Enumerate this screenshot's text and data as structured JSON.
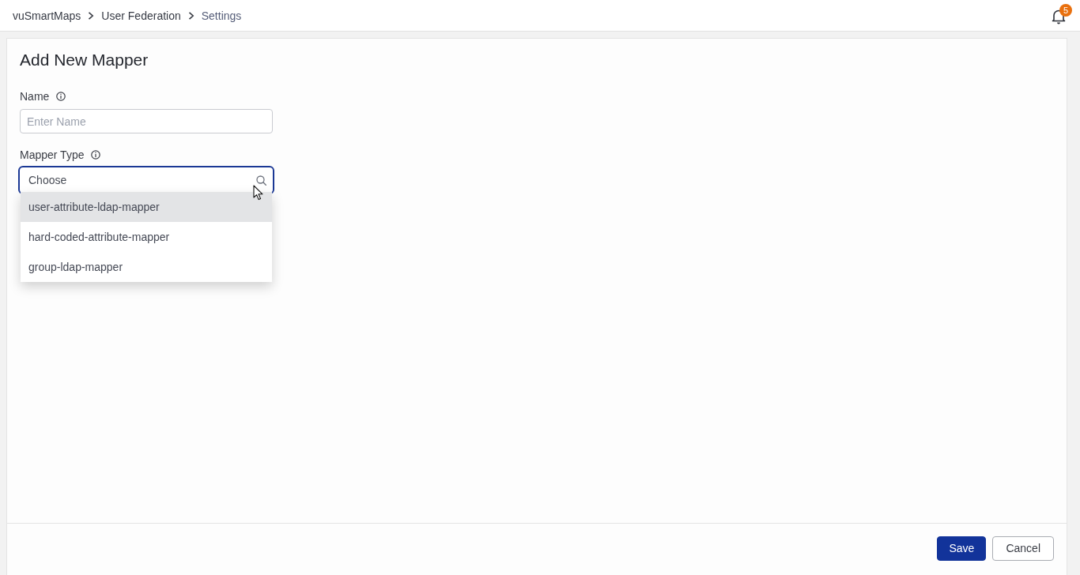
{
  "breadcrumb": [
    {
      "label": "vuSmartMaps",
      "current": false
    },
    {
      "label": "User Federation",
      "current": false
    },
    {
      "label": "Settings",
      "current": true
    }
  ],
  "notifications": {
    "count": "5"
  },
  "form": {
    "title": "Add New Mapper",
    "fields": [
      {
        "kind": "text",
        "label": "Name",
        "placeholder": "Enter Name"
      },
      {
        "kind": "select",
        "label": "Mapper Type",
        "placeholder": "Choose",
        "focused": true,
        "expanded": true,
        "options": [
          {
            "label": "user-attribute-ldap-mapper",
            "selected": true
          },
          {
            "label": "hard-coded-attribute-mapper",
            "selected": false
          },
          {
            "label": "group-ldap-mapper",
            "selected": false
          }
        ]
      }
    ]
  },
  "buttons": [
    {
      "label": "Save",
      "kind": "primary"
    },
    {
      "label": "Cancel",
      "kind": "secondary"
    }
  ]
}
